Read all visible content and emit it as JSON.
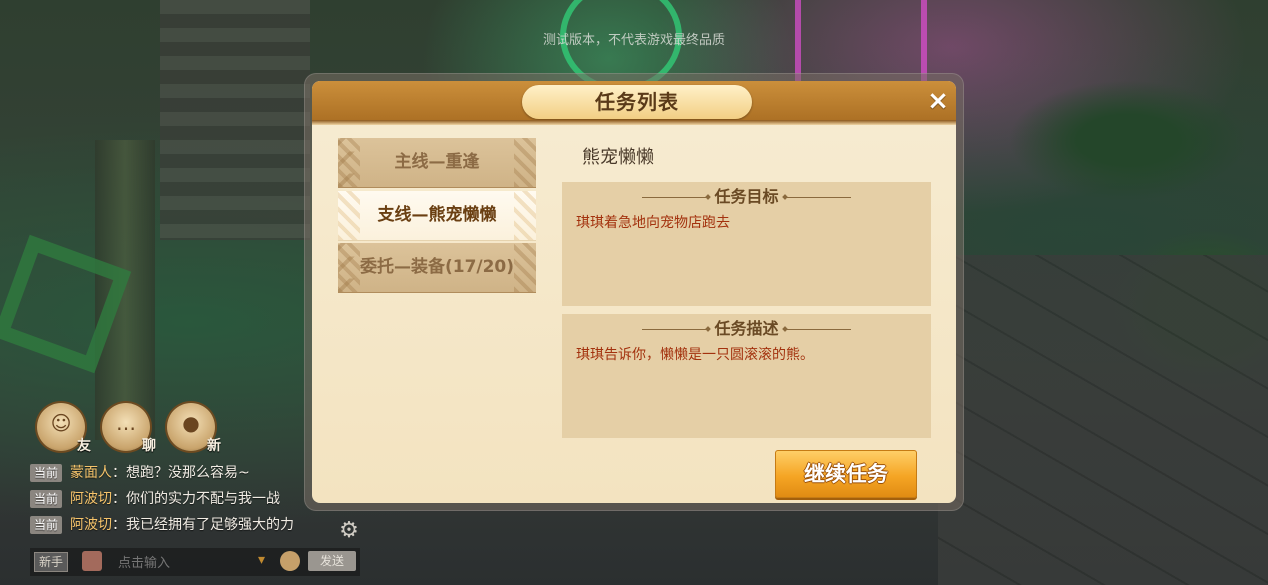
{
  "watermark": "测试版本，不代表游戏最终品质",
  "dialog": {
    "title": "任务列表",
    "close_icon": "×",
    "tabs": [
      {
        "label": "主线—重逢",
        "selected": false
      },
      {
        "label": "支线—熊宠懒懒",
        "selected": true
      },
      {
        "label": "委托—装备(17/20)",
        "selected": false
      }
    ],
    "quest_name": "熊宠懒懒",
    "target_title": "任务目标",
    "target_text": "琪琪着急地向宠物店跑去",
    "desc_title": "任务描述",
    "desc_text": "琪琪告诉你，懒懒是一只圆滚滚的熊。",
    "continue_label": "继续任务"
  },
  "hud": {
    "friend_label": "友",
    "chat_label": "聊",
    "new_label": "新"
  },
  "chat": {
    "lines": [
      {
        "channel": "当前",
        "speaker": "蒙面人",
        "text": "：想跑？没那么容易~"
      },
      {
        "channel": "当前",
        "speaker": "阿波切",
        "text": "：你们的实力不配与我一战"
      },
      {
        "channel": "当前",
        "speaker": "阿波切",
        "text": "：我已经拥有了足够强大的力"
      }
    ],
    "channel_button": "新手",
    "input_placeholder": "点击输入",
    "send_label": "发送"
  },
  "colors": {
    "title_bar": "#b97a2c",
    "quest_text_red": "#a3320e",
    "continue_button": "#f5a524"
  }
}
